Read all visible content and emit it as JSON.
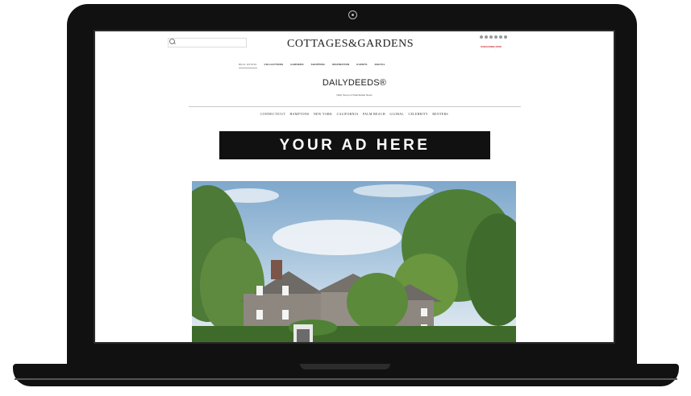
{
  "site": {
    "logo": "COTTAGES&GARDENS",
    "subscribe": "SUBSCRIBE NOW",
    "subscribe_sub": "..."
  },
  "main_nav": [
    {
      "label": "REAL ESTATE",
      "active": true
    },
    {
      "label": "COLLECTIONS"
    },
    {
      "label": "GARDENS"
    },
    {
      "label": "SHOPPING"
    },
    {
      "label": "INSPIRATION"
    },
    {
      "label": "EVENTS"
    },
    {
      "label": "DIGITAL"
    }
  ],
  "dailydeeds": {
    "title": "DAILYDEEDS®",
    "subtitle": "Daily Scoop of Real Estate News"
  },
  "regions": [
    "CONNECTICUT",
    "HAMPTONS",
    "NEW YORK",
    "CALIFORNIA",
    "PALM BEACH",
    "GLOBAL",
    "CELEBRITY",
    "RENTERS"
  ],
  "ad": {
    "text": "YOUR AD HERE"
  },
  "icons": [
    "search-icon",
    "facebook-icon",
    "twitter-icon",
    "pinterest-icon",
    "instagram-icon",
    "email-icon",
    "camera-icon"
  ]
}
